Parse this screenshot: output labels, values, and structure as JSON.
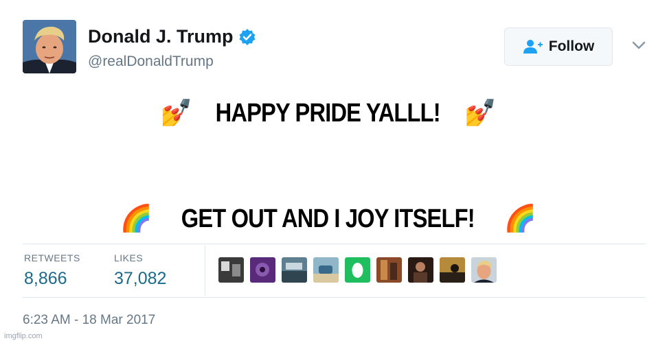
{
  "profile": {
    "name": "Donald J. Trump",
    "handle": "@realDonaldTrump",
    "avatar_icon": "profile-photo",
    "verified_icon": "verified-badge-icon",
    "verified_color": "#1da1f2"
  },
  "header": {
    "follow_label": "Follow",
    "follow_icon": "add-user-icon",
    "menu_icon": "chevron-down-icon"
  },
  "tweet": {
    "line1": {
      "emoji_left": "💅",
      "text": "HAPPY PRIDE YALLL!",
      "emoji_right": "💅"
    },
    "line2": {
      "emoji_left": "🌈",
      "text": "GET OUT AND I JOY ITSELF!",
      "emoji_right": "🌈"
    }
  },
  "stats": {
    "retweets_label": "RETWEETS",
    "retweets_value": "8,866",
    "likes_label": "LIKES",
    "likes_value": "37,082",
    "value_color": "#1b6a8a"
  },
  "likers": [
    {
      "icon": "liker-avatar-1",
      "color": "#3a3a3a"
    },
    {
      "icon": "liker-avatar-2",
      "color": "#5a2a7a"
    },
    {
      "icon": "liker-avatar-3",
      "color": "#5d7f8f"
    },
    {
      "icon": "liker-avatar-4",
      "color": "#8fb7c9"
    },
    {
      "icon": "liker-avatar-5",
      "color": "#1fbf5f"
    },
    {
      "icon": "liker-avatar-6",
      "color": "#8a4a2a"
    },
    {
      "icon": "liker-avatar-7",
      "color": "#5a3a2a"
    },
    {
      "icon": "liker-avatar-8",
      "color": "#b58a3a"
    },
    {
      "icon": "liker-avatar-9",
      "color": "#c9d3db"
    }
  ],
  "timestamp": "6:23 AM - 18 Mar 2017",
  "watermark": "imgflip.com"
}
